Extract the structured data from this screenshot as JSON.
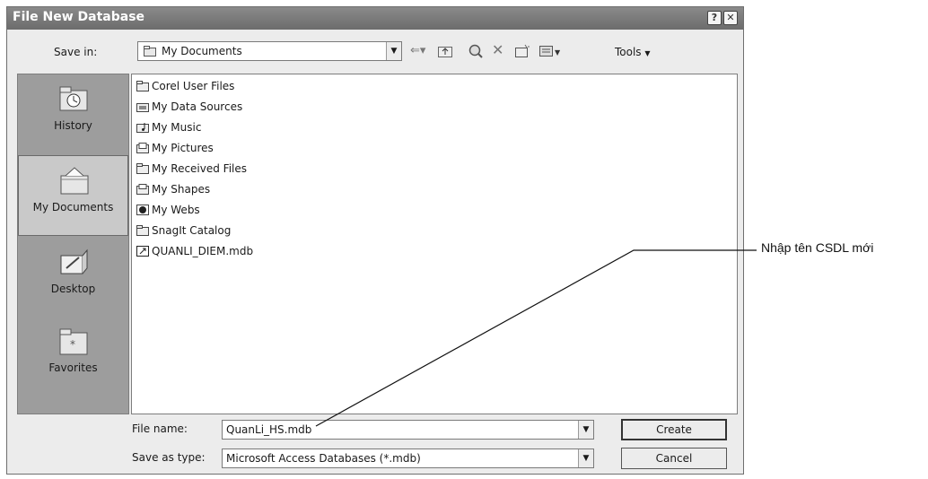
{
  "window": {
    "title": "File New Database",
    "help_button": "?",
    "close_button": "✕"
  },
  "save_in": {
    "label": "Save in:",
    "value": "My Documents"
  },
  "toolbar": {
    "tools_label": "Tools"
  },
  "places": [
    {
      "label": "History",
      "icon": "history-icon"
    },
    {
      "label": "My Documents",
      "icon": "my-documents-icon"
    },
    {
      "label": "Desktop",
      "icon": "desktop-icon"
    },
    {
      "label": "Favorites",
      "icon": "favorites-icon"
    }
  ],
  "files": [
    {
      "name": "Corel User Files",
      "icon": "folder-icon"
    },
    {
      "name": "My Data Sources",
      "icon": "data-sources-folder-icon"
    },
    {
      "name": "My Music",
      "icon": "music-folder-icon"
    },
    {
      "name": "My Pictures",
      "icon": "pictures-folder-icon"
    },
    {
      "name": "My Received Files",
      "icon": "folder-icon"
    },
    {
      "name": "My Shapes",
      "icon": "shapes-folder-icon"
    },
    {
      "name": "My Webs",
      "icon": "webs-folder-icon"
    },
    {
      "name": "SnagIt Catalog",
      "icon": "folder-icon"
    },
    {
      "name": "QUANLI_DIEM.mdb",
      "icon": "access-database-icon"
    }
  ],
  "file_name": {
    "label": "File name:",
    "value": "QuanLi_HS.mdb"
  },
  "save_as_type": {
    "label": "Save as type:",
    "value": "Microsoft Access Databases (*.mdb)"
  },
  "buttons": {
    "create": "Create",
    "cancel": "Cancel"
  },
  "annotation": {
    "text": "Nhập tên CSDL mới"
  }
}
